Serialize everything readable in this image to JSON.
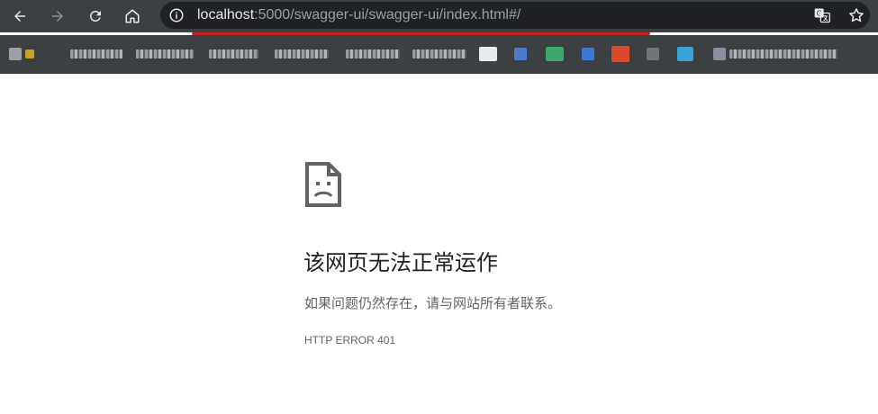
{
  "browser": {
    "url_host": "localhost",
    "url_path": ":5000/swagger-ui/swagger-ui/index.html#/",
    "icons": [
      "back-arrow-icon",
      "forward-arrow-icon",
      "reload-icon",
      "home-icon",
      "info-icon",
      "translate-icon",
      "star-icon"
    ],
    "bookmark_count": 17
  },
  "error": {
    "icon": "broken-page-icon",
    "title": "该网页无法正常运作",
    "message": "如果问题仍然存在，请与网站所有者联系。",
    "code": "HTTP ERROR 401"
  },
  "colors": {
    "toolbar_bg": "#3c4043",
    "omnibox_bg": "#202124",
    "underline_red": "#c5221f",
    "title_text": "#202124",
    "body_text": "#5f6368"
  }
}
